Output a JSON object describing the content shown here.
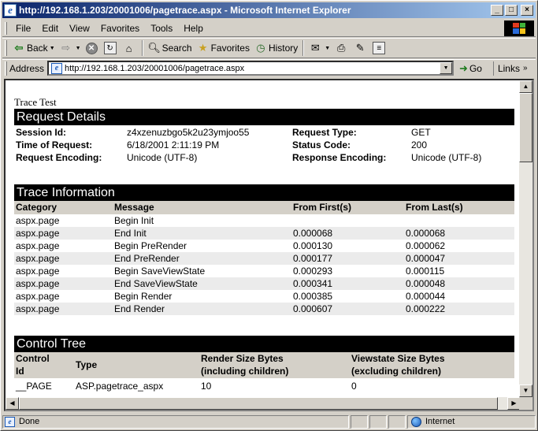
{
  "window": {
    "title": "http://192.168.1.203/20001006/pagetrace.aspx - Microsoft Internet Explorer",
    "minimize": "_",
    "maximize": "□",
    "close": "×"
  },
  "menu": [
    {
      "label": "File"
    },
    {
      "label": "Edit"
    },
    {
      "label": "View"
    },
    {
      "label": "Favorites"
    },
    {
      "label": "Tools"
    },
    {
      "label": "Help"
    }
  ],
  "toolbar": {
    "back": "Back",
    "search": "Search",
    "favorites": "Favorites",
    "history": "History"
  },
  "address": {
    "label": "Address",
    "url": "http://192.168.1.203/20001006/pagetrace.aspx",
    "go": "Go",
    "links": "Links"
  },
  "page": {
    "heading": "Trace Test",
    "request_details": {
      "title": "Request Details",
      "session_id_label": "Session Id:",
      "session_id": "z4xzenuzbgo5k2u23ymjoo55",
      "request_type_label": "Request Type:",
      "request_type": "GET",
      "time_label": "Time of Request:",
      "time": "6/18/2001 2:11:19 PM",
      "status_label": "Status Code:",
      "status": "200",
      "req_enc_label": "Request Encoding:",
      "req_enc": "Unicode (UTF-8)",
      "resp_enc_label": "Response Encoding:",
      "resp_enc": "Unicode (UTF-8)"
    },
    "trace_info": {
      "title": "Trace Information",
      "columns": [
        "Category",
        "Message",
        "From First(s)",
        "From Last(s)"
      ],
      "rows": [
        [
          "aspx.page",
          "Begin Init",
          "",
          ""
        ],
        [
          "aspx.page",
          "End Init",
          "0.000068",
          "0.000068"
        ],
        [
          "aspx.page",
          "Begin PreRender",
          "0.000130",
          "0.000062"
        ],
        [
          "aspx.page",
          "End PreRender",
          "0.000177",
          "0.000047"
        ],
        [
          "aspx.page",
          "Begin SaveViewState",
          "0.000293",
          "0.000115"
        ],
        [
          "aspx.page",
          "End SaveViewState",
          "0.000341",
          "0.000048"
        ],
        [
          "aspx.page",
          "Begin Render",
          "0.000385",
          "0.000044"
        ],
        [
          "aspx.page",
          "End Render",
          "0.000607",
          "0.000222"
        ]
      ]
    },
    "control_tree": {
      "title": "Control Tree",
      "col_id_1": "Control",
      "col_id_2": "Id",
      "col_type": "Type",
      "col_render_1": "Render Size Bytes",
      "col_render_2": "(including children)",
      "col_vs_1": "Viewstate Size Bytes",
      "col_vs_2": "(excluding children)",
      "rows": [
        [
          "__PAGE",
          "ASP.pagetrace_aspx",
          "10",
          "0"
        ]
      ]
    }
  },
  "status": {
    "text": "Done",
    "zone": "Internet"
  },
  "icons": {
    "app": "ie-logo-icon",
    "page": "page-icon",
    "globe": "internet-zone-icon"
  }
}
